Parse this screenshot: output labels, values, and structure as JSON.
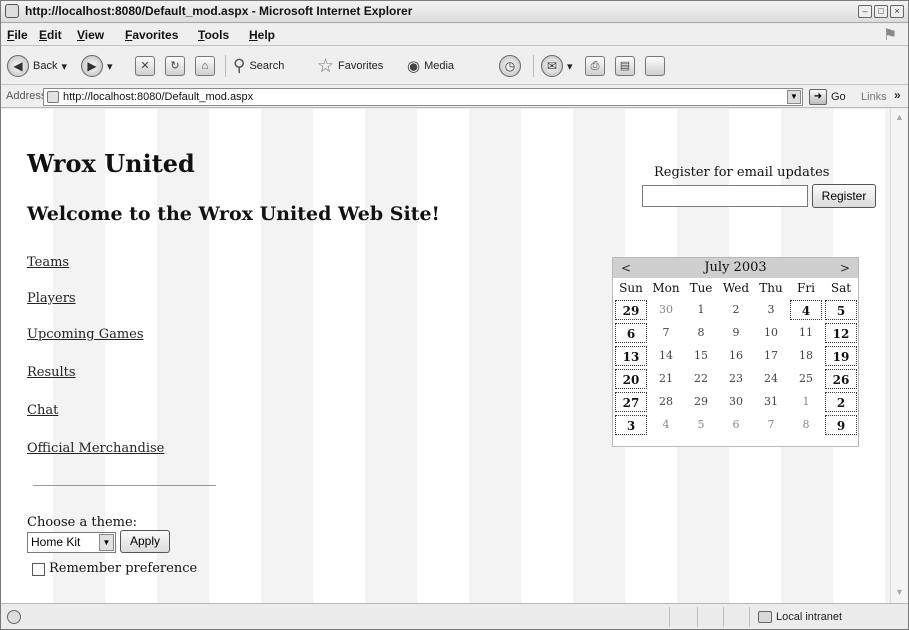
{
  "window": {
    "title": "http://localhost:8080/Default_mod.aspx - Microsoft Internet Explorer"
  },
  "menubar": {
    "items": [
      "File",
      "Edit",
      "View",
      "Favorites",
      "Tools",
      "Help"
    ]
  },
  "toolbar": {
    "back_label": "Back",
    "search_label": "Search",
    "favorites_label": "Favorites",
    "media_label": "Media"
  },
  "addressbar": {
    "label": "Address",
    "url": "http://localhost:8080/Default_mod.aspx",
    "go_label": "Go",
    "links_label": "Links"
  },
  "page": {
    "site_title": "Wrox United",
    "welcome": "Welcome to the Wrox United Web Site!",
    "nav": [
      "Teams",
      "Players",
      "Upcoming Games",
      "Results",
      "Chat",
      "Official Merchandise"
    ],
    "theme": {
      "label": "Choose a theme:",
      "selected": "Home Kit",
      "apply_label": "Apply",
      "remember_label": "Remember preference",
      "remember_checked": false
    },
    "register": {
      "label": "Register for email updates",
      "input_value": "",
      "button_label": "Register"
    },
    "calendar": {
      "prev": "<",
      "next": ">",
      "title": "July 2003",
      "days_of_week": [
        "Sun",
        "Mon",
        "Tue",
        "Wed",
        "Thu",
        "Fri",
        "Sat"
      ],
      "weeks": [
        [
          "29",
          "30",
          "1",
          "2",
          "3",
          "4",
          "5"
        ],
        [
          "6",
          "7",
          "8",
          "9",
          "10",
          "11",
          "12"
        ],
        [
          "13",
          "14",
          "15",
          "16",
          "17",
          "18",
          "19"
        ],
        [
          "20",
          "21",
          "22",
          "23",
          "24",
          "25",
          "26"
        ],
        [
          "27",
          "28",
          "29",
          "30",
          "31",
          "1",
          "2"
        ],
        [
          "3",
          "4",
          "5",
          "6",
          "7",
          "8",
          "9"
        ]
      ]
    }
  },
  "statusbar": {
    "zone": "Local intranet"
  },
  "colors": {
    "calendar_header": "#cfcfcf",
    "page_stripe": "#f3f3f3"
  }
}
